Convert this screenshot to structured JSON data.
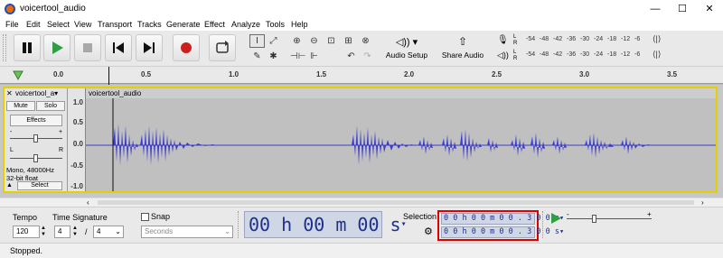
{
  "window": {
    "title": "voicertool_audio",
    "minimize": "—",
    "maximize": "☐",
    "close": "✕"
  },
  "menu": [
    "File",
    "Edit",
    "Select",
    "View",
    "Transport",
    "Tracks",
    "Generate",
    "Effect",
    "Analyze",
    "Tools",
    "Help"
  ],
  "toolbar": {
    "audio_setup_label": "Audio Setup",
    "share_audio_label": "Share Audio",
    "meter_ticks": [
      "-54",
      "-48",
      "-42",
      "-36",
      "-30",
      "-24",
      "-18",
      "-12",
      "-6"
    ],
    "meter_channels": [
      "L",
      "R"
    ]
  },
  "ruler": {
    "ticks": [
      "0.0",
      "0.5",
      "1.0",
      "1.5",
      "2.0",
      "2.5",
      "3.0",
      "3.5"
    ]
  },
  "track": {
    "name": "voicertool_a",
    "mute": "Mute",
    "solo": "Solo",
    "effects": "Effects",
    "pan_left": "L",
    "pan_right": "R",
    "gain_minus": "-",
    "gain_plus": "+",
    "info_line1": "Mono, 48000Hz",
    "info_line2": "32-bit float",
    "select": "Select",
    "clip_name": "voicertool_audio",
    "scale": [
      "1.0",
      "0.5",
      "0.0",
      "-0.5",
      "-1.0"
    ]
  },
  "bottom": {
    "tempo_label": "Tempo",
    "tempo_value": "120",
    "time_sig_label": "Time Signature",
    "time_sig_num": "4",
    "time_sig_sep": "/",
    "time_sig_den": "4",
    "snap_label": "Snap",
    "snap_unit": "Seconds",
    "big_time": "00 h 00 m 00 s",
    "selection_label": "Selection",
    "sel_start": "0 0 h 0 0 m 0 0 . 3 0 0 s",
    "sel_end": "0 0 h 0 0 m 0 0 . 3 0 0 s",
    "play_speed_minus": "-",
    "play_speed_plus": "+"
  },
  "status": {
    "text": "Stopped."
  },
  "colors": {
    "waveform": "#3c3ccc",
    "selection_highlight": "#e00000",
    "track_focus": "#e3d000",
    "play_green": "#2f9e44",
    "record_red": "#cc1f1f"
  },
  "icons": [
    "audacity-logo-icon",
    "pause-icon",
    "play-icon",
    "stop-icon",
    "skip-start-icon",
    "skip-end-icon",
    "record-icon",
    "loop-icon",
    "select-tool-icon",
    "envelope-tool-icon",
    "draw-tool-icon",
    "multi-tool-icon",
    "zoom-in-icon",
    "zoom-out-icon",
    "fit-selection-icon",
    "fit-project-icon",
    "zoom-toggle-icon",
    "trim-icon",
    "silence-icon",
    "undo-icon",
    "redo-icon",
    "speaker-icon",
    "share-icon",
    "mic-icon",
    "gear-icon"
  ]
}
